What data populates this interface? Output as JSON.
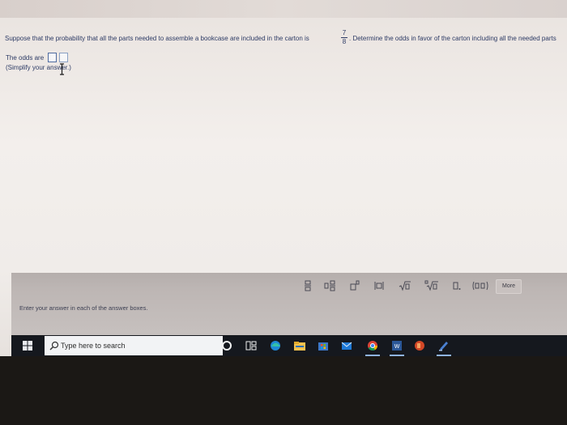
{
  "question": {
    "text_before": "Suppose that the probability that all the parts needed to assemble a bookcase are included in the carton is",
    "fraction_numerator": "7",
    "fraction_denominator": "8",
    "text_after": ". Determine the odds in favor of the carton including all the needed parts"
  },
  "answer": {
    "label": "The odds are",
    "hint": "(Simplify your answer.)"
  },
  "math_toolbar": {
    "more_label": "More"
  },
  "status": {
    "text": "Enter your answer in each of the answer boxes."
  },
  "taskbar": {
    "search_placeholder": "Type here to search"
  }
}
